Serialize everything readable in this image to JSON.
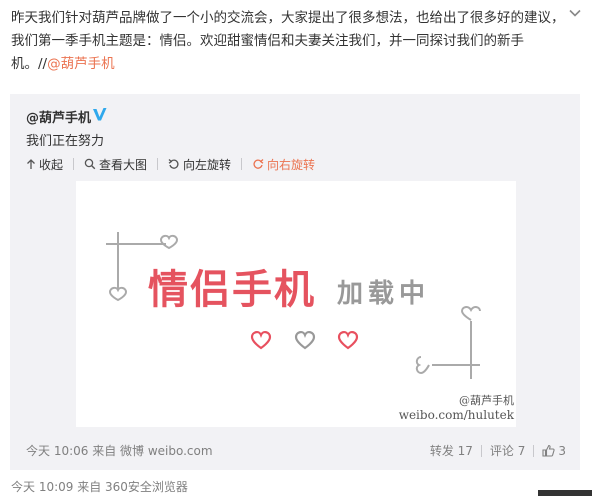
{
  "post": {
    "text_main": "昨天我们针对葫芦品牌做了一个小的交流会，大家提出了很多想法，也给出了很多好的建议，我们第一季手机主题是：情侣。欢迎甜蜜情侣和夫妻关注我们，并一同探讨我们的新手机。//",
    "mention": "@葫芦手机"
  },
  "repost": {
    "author": "@葫芦手机",
    "text": "我们正在努力",
    "toolbar": {
      "collapse": "收起",
      "view_large": "查看大图",
      "rotate_left": "向左旋转",
      "rotate_right": "向右旋转"
    },
    "image": {
      "headline": "情侣手机",
      "subline": "加载中",
      "watermark_top": "@葫芦手机",
      "watermark_url": "weibo.com/hulutek"
    },
    "footer": {
      "time": "今天 10:06 来自 微博 weibo.com",
      "repost": "转发 17",
      "comment": "评论 7",
      "likes": "3"
    }
  },
  "meta": {
    "time": "今天 10:09 来自 360安全浏览器"
  },
  "colors": {
    "accent": "#eb7350",
    "headline": "#e5535f",
    "subline": "#999999",
    "heart_red": "#e8505f",
    "heart_gray": "#999999"
  }
}
